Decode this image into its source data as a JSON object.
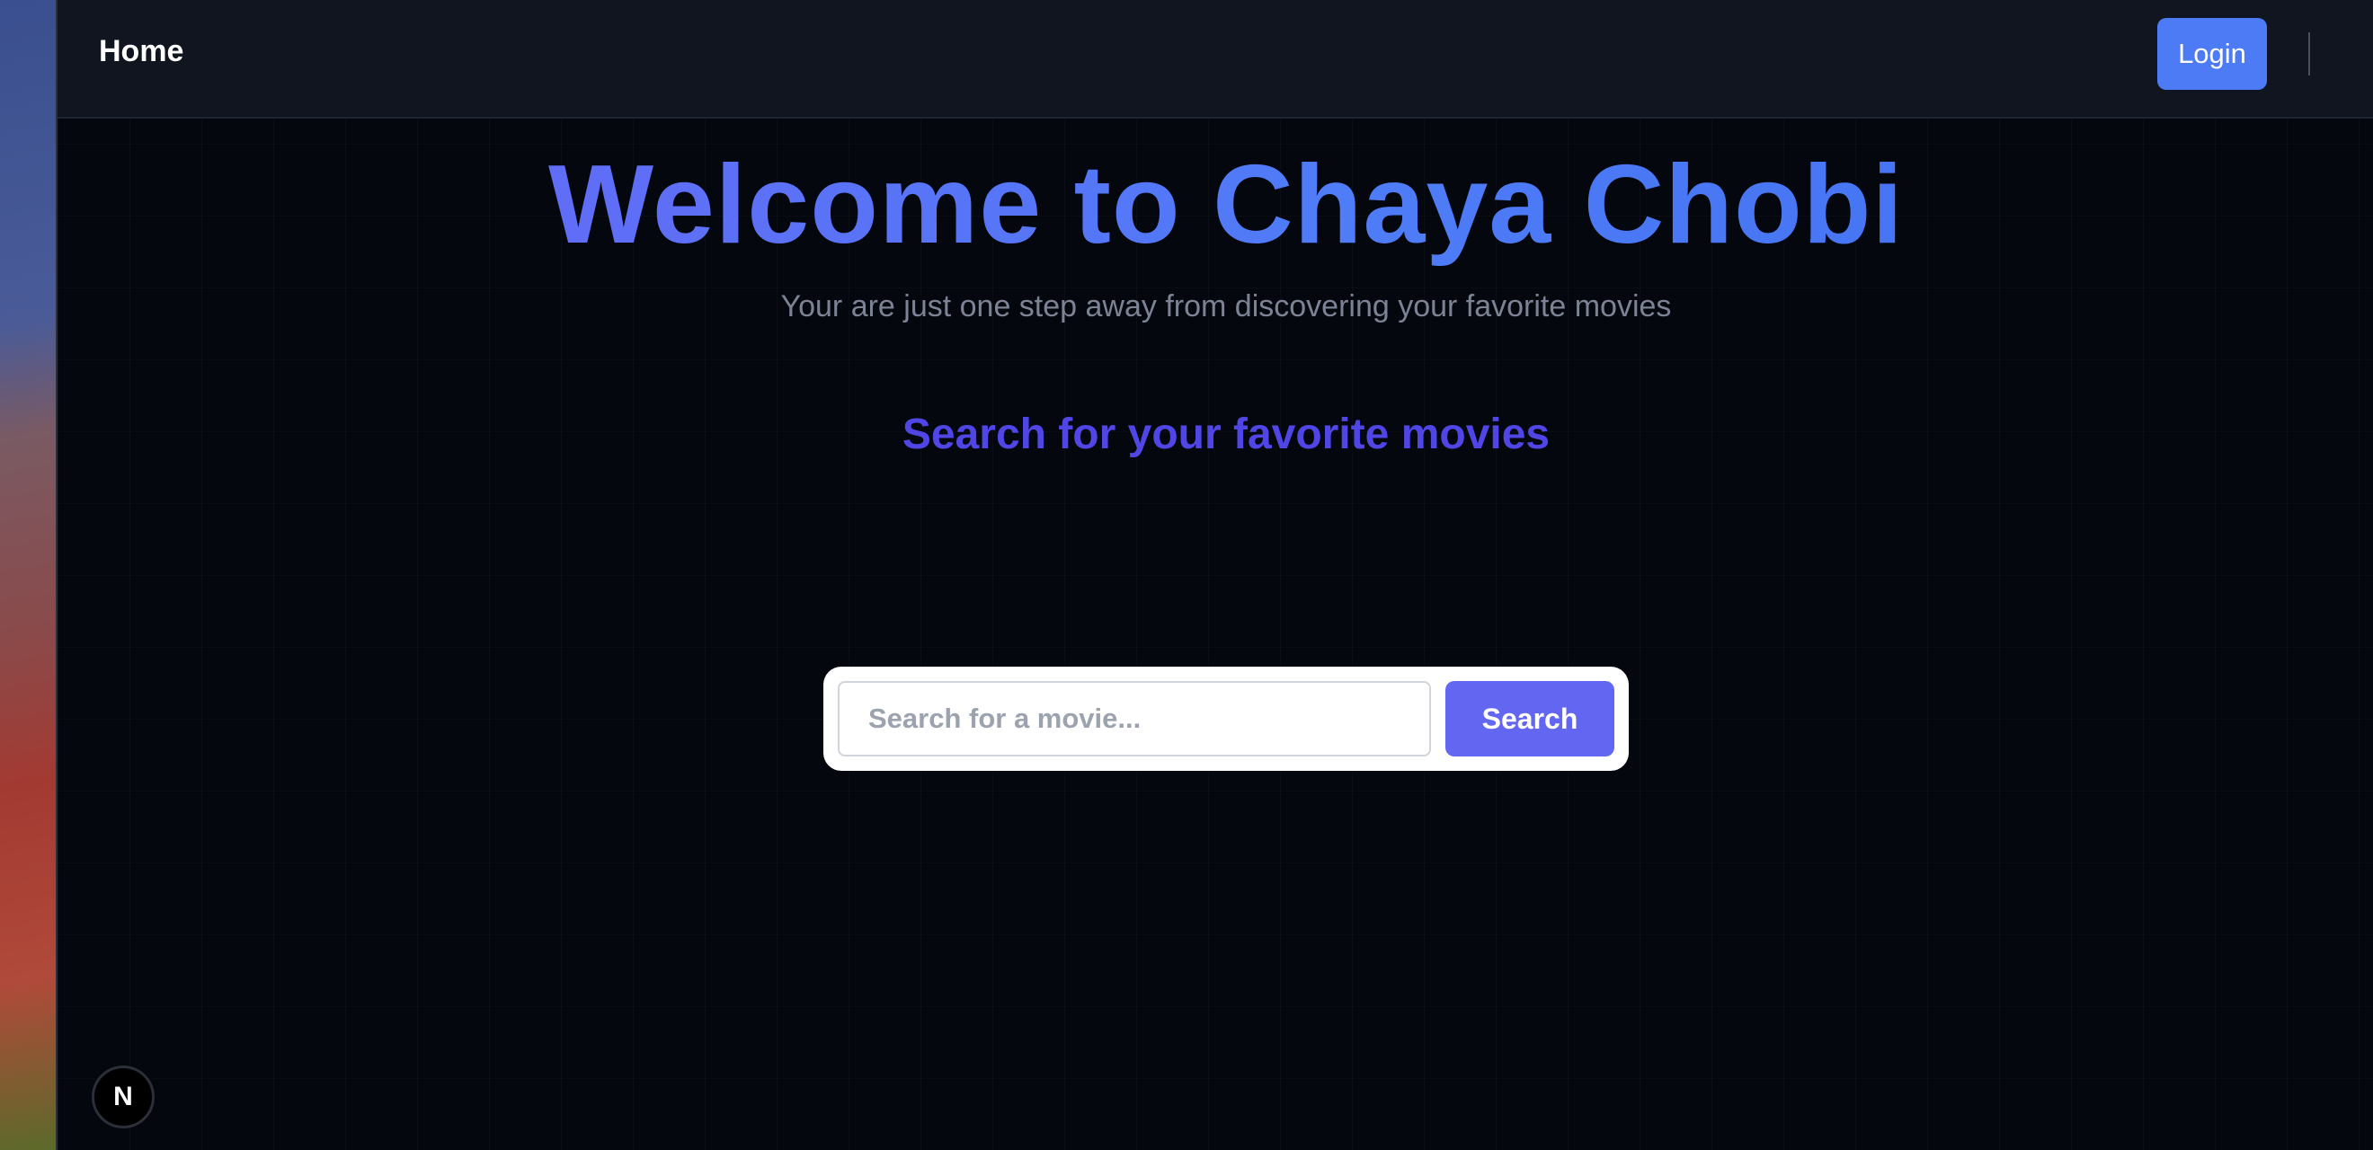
{
  "navbar": {
    "home_label": "Home",
    "login_label": "Login"
  },
  "hero": {
    "title": "Welcome to Chaya Chobi",
    "subtitle": "Your are just one step away from discovering your favorite movies"
  },
  "search": {
    "heading": "Search for your favorite movies",
    "placeholder": "Search for a movie...",
    "value": "",
    "button_label": "Search"
  },
  "devtools": {
    "badge_letter": "N",
    "icon": "nextjs-logo-icon"
  },
  "colors": {
    "accent": "#6366f1",
    "login": "#4c7bf5",
    "background": "#05070f",
    "heading": "#5046e6"
  }
}
